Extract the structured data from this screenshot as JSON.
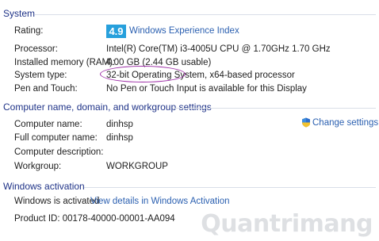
{
  "system": {
    "heading": "System",
    "rating_label": "Rating:",
    "rating_score": "4.9",
    "rating_link": "Windows Experience Index",
    "processor_label": "Processor:",
    "processor_value": "Intel(R) Core(TM) i3-4005U CPU @ 1.70GHz   1.70 GHz",
    "memory_label": "Installed memory (RAM):",
    "memory_value": "4.00 GB (2.44 GB usable)",
    "type_label": "System type:",
    "type_value_bits": "32-bit Operating System,",
    "type_value_proc": "x64-based processor",
    "pen_label": "Pen and Touch:",
    "pen_value": "No Pen or Touch Input is available for this Display"
  },
  "computer": {
    "heading": "Computer name, domain, and workgroup settings",
    "change_settings": "Change settings",
    "name_label": "Computer name:",
    "name_value": "dinhsp",
    "full_name_label": "Full computer name:",
    "full_name_value": "dinhsp",
    "description_label": "Computer description:",
    "workgroup_label": "Workgroup:",
    "workgroup_value": "WORKGROUP"
  },
  "activation": {
    "heading": "Windows activation",
    "status": "Windows is activated",
    "details_link": "View details in Windows Activation",
    "product_id": "Product ID: 00178-40000-00001-AA094"
  },
  "watermark": "Quantrimang",
  "colors": {
    "accent": "#2a5fb0",
    "badge": "#27a0dc",
    "annotation": "#9c2aa6"
  }
}
